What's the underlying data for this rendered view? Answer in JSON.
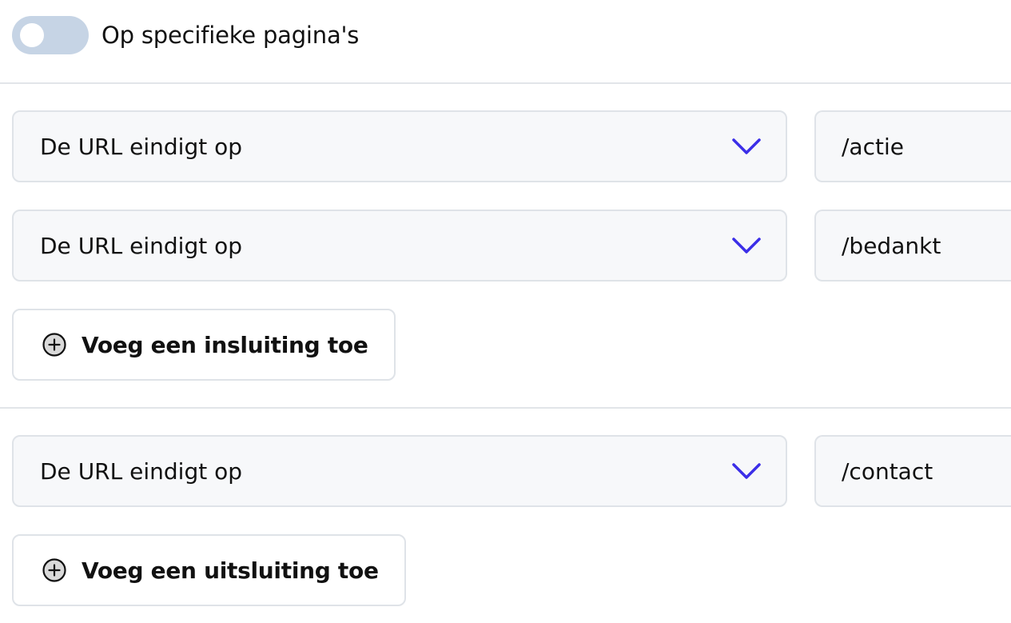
{
  "toggle": {
    "label": "Op specifieke pagina's",
    "state": "off"
  },
  "inclusions": [
    {
      "condition": "De URL eindigt op",
      "value": "/actie"
    },
    {
      "condition": "De URL eindigt op",
      "value": "/bedankt"
    }
  ],
  "add_inclusion_label": "Voeg een insluiting toe",
  "exclusions": [
    {
      "condition": "De URL eindigt op",
      "value": "/contact"
    }
  ],
  "add_exclusion_label": "Voeg een uitsluiting toe",
  "colors": {
    "accent": "#3b2ee8",
    "toggle_off": "#c6d4e5"
  },
  "icons": {
    "dropdown": "chevron-down-icon",
    "add": "plus-circle-icon"
  }
}
